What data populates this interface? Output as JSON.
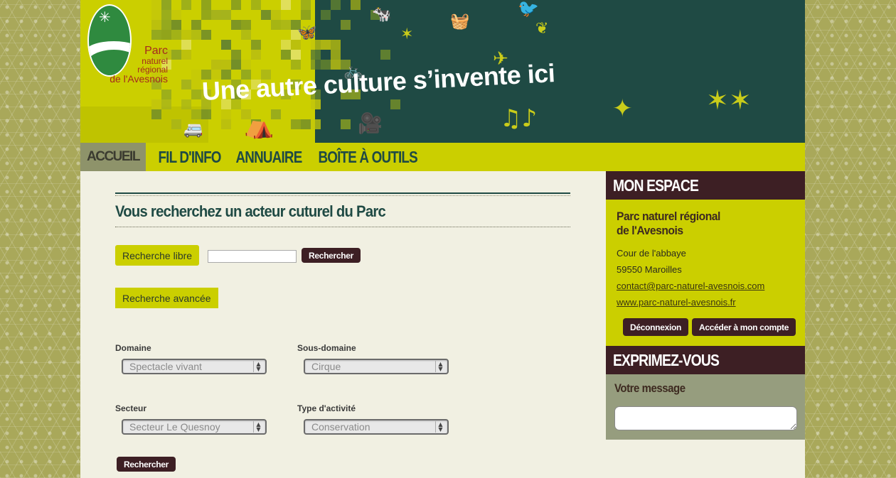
{
  "banner": {
    "logo": {
      "line1": "Parc",
      "line2": "naturel",
      "line3": "régional",
      "line4": "de l'Avesnois"
    },
    "tagline": "Une autre culture s’invente ici"
  },
  "nav": {
    "items": [
      {
        "label": "ACCUEIL",
        "active": true
      },
      {
        "label": "FIL D'INFO",
        "active": false
      },
      {
        "label": "ANNUAIRE",
        "active": false
      },
      {
        "label": "BOÎTE À OUTILS",
        "active": false
      }
    ]
  },
  "main": {
    "title": "Vous recherchez un acteur cuturel du Parc",
    "free_search_label": "Recherche libre",
    "free_search_value": "",
    "search_button": "Rechercher",
    "advanced_label": "Recherche avancée",
    "fields": {
      "domaine": {
        "label": "Domaine",
        "value": "Spectacle vivant"
      },
      "sous_domaine": {
        "label": "Sous-domaine",
        "value": "Cirque"
      },
      "secteur": {
        "label": "Secteur",
        "value": "Secteur Le Quesnoy"
      },
      "type_activite": {
        "label": "Type d'activité",
        "value": "Conservation"
      }
    },
    "submit_button": "Rechercher"
  },
  "sidebar": {
    "espace_title": "MON ESPACE",
    "org_line1": "Parc naturel régional",
    "org_line2": "de l'Avesnois",
    "address1": "Cour de l'abbaye",
    "address2": "59550 Maroilles",
    "email": "contact@parc-naturel-avesnois.com",
    "website": "www.parc-naturel-avesnois.fr",
    "logout_button": "Déconnexion",
    "account_button": "Accéder à mon compte",
    "express_title": "EXPRIMEZ-VOUS",
    "message_label": "Votre message",
    "message_value": ""
  },
  "colors": {
    "lime": "#cbcf00",
    "dark_green": "#1f4a44",
    "dark_brown": "#3d1f24",
    "olive_bg": "#a9a85a",
    "content_bg": "#f1f0e2"
  }
}
